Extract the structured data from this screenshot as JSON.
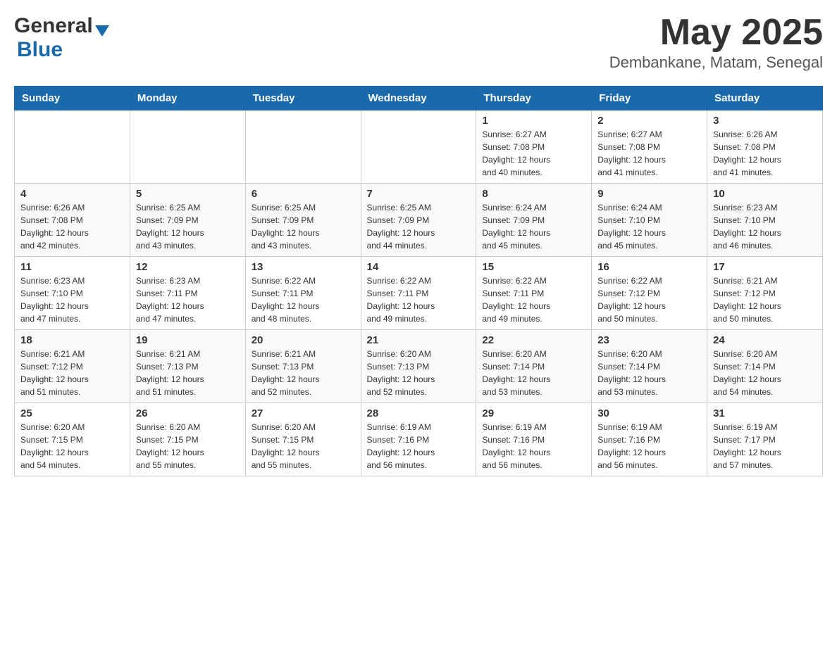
{
  "header": {
    "month_year": "May 2025",
    "location": "Dembankane, Matam, Senegal",
    "logo_general": "General",
    "logo_blue": "Blue"
  },
  "weekdays": [
    "Sunday",
    "Monday",
    "Tuesday",
    "Wednesday",
    "Thursday",
    "Friday",
    "Saturday"
  ],
  "weeks": [
    {
      "days": [
        {
          "date": "",
          "info": ""
        },
        {
          "date": "",
          "info": ""
        },
        {
          "date": "",
          "info": ""
        },
        {
          "date": "",
          "info": ""
        },
        {
          "date": "1",
          "info": "Sunrise: 6:27 AM\nSunset: 7:08 PM\nDaylight: 12 hours\nand 40 minutes."
        },
        {
          "date": "2",
          "info": "Sunrise: 6:27 AM\nSunset: 7:08 PM\nDaylight: 12 hours\nand 41 minutes."
        },
        {
          "date": "3",
          "info": "Sunrise: 6:26 AM\nSunset: 7:08 PM\nDaylight: 12 hours\nand 41 minutes."
        }
      ]
    },
    {
      "days": [
        {
          "date": "4",
          "info": "Sunrise: 6:26 AM\nSunset: 7:08 PM\nDaylight: 12 hours\nand 42 minutes."
        },
        {
          "date": "5",
          "info": "Sunrise: 6:25 AM\nSunset: 7:09 PM\nDaylight: 12 hours\nand 43 minutes."
        },
        {
          "date": "6",
          "info": "Sunrise: 6:25 AM\nSunset: 7:09 PM\nDaylight: 12 hours\nand 43 minutes."
        },
        {
          "date": "7",
          "info": "Sunrise: 6:25 AM\nSunset: 7:09 PM\nDaylight: 12 hours\nand 44 minutes."
        },
        {
          "date": "8",
          "info": "Sunrise: 6:24 AM\nSunset: 7:09 PM\nDaylight: 12 hours\nand 45 minutes."
        },
        {
          "date": "9",
          "info": "Sunrise: 6:24 AM\nSunset: 7:10 PM\nDaylight: 12 hours\nand 45 minutes."
        },
        {
          "date": "10",
          "info": "Sunrise: 6:23 AM\nSunset: 7:10 PM\nDaylight: 12 hours\nand 46 minutes."
        }
      ]
    },
    {
      "days": [
        {
          "date": "11",
          "info": "Sunrise: 6:23 AM\nSunset: 7:10 PM\nDaylight: 12 hours\nand 47 minutes."
        },
        {
          "date": "12",
          "info": "Sunrise: 6:23 AM\nSunset: 7:11 PM\nDaylight: 12 hours\nand 47 minutes."
        },
        {
          "date": "13",
          "info": "Sunrise: 6:22 AM\nSunset: 7:11 PM\nDaylight: 12 hours\nand 48 minutes."
        },
        {
          "date": "14",
          "info": "Sunrise: 6:22 AM\nSunset: 7:11 PM\nDaylight: 12 hours\nand 49 minutes."
        },
        {
          "date": "15",
          "info": "Sunrise: 6:22 AM\nSunset: 7:11 PM\nDaylight: 12 hours\nand 49 minutes."
        },
        {
          "date": "16",
          "info": "Sunrise: 6:22 AM\nSunset: 7:12 PM\nDaylight: 12 hours\nand 50 minutes."
        },
        {
          "date": "17",
          "info": "Sunrise: 6:21 AM\nSunset: 7:12 PM\nDaylight: 12 hours\nand 50 minutes."
        }
      ]
    },
    {
      "days": [
        {
          "date": "18",
          "info": "Sunrise: 6:21 AM\nSunset: 7:12 PM\nDaylight: 12 hours\nand 51 minutes."
        },
        {
          "date": "19",
          "info": "Sunrise: 6:21 AM\nSunset: 7:13 PM\nDaylight: 12 hours\nand 51 minutes."
        },
        {
          "date": "20",
          "info": "Sunrise: 6:21 AM\nSunset: 7:13 PM\nDaylight: 12 hours\nand 52 minutes."
        },
        {
          "date": "21",
          "info": "Sunrise: 6:20 AM\nSunset: 7:13 PM\nDaylight: 12 hours\nand 52 minutes."
        },
        {
          "date": "22",
          "info": "Sunrise: 6:20 AM\nSunset: 7:14 PM\nDaylight: 12 hours\nand 53 minutes."
        },
        {
          "date": "23",
          "info": "Sunrise: 6:20 AM\nSunset: 7:14 PM\nDaylight: 12 hours\nand 53 minutes."
        },
        {
          "date": "24",
          "info": "Sunrise: 6:20 AM\nSunset: 7:14 PM\nDaylight: 12 hours\nand 54 minutes."
        }
      ]
    },
    {
      "days": [
        {
          "date": "25",
          "info": "Sunrise: 6:20 AM\nSunset: 7:15 PM\nDaylight: 12 hours\nand 54 minutes."
        },
        {
          "date": "26",
          "info": "Sunrise: 6:20 AM\nSunset: 7:15 PM\nDaylight: 12 hours\nand 55 minutes."
        },
        {
          "date": "27",
          "info": "Sunrise: 6:20 AM\nSunset: 7:15 PM\nDaylight: 12 hours\nand 55 minutes."
        },
        {
          "date": "28",
          "info": "Sunrise: 6:19 AM\nSunset: 7:16 PM\nDaylight: 12 hours\nand 56 minutes."
        },
        {
          "date": "29",
          "info": "Sunrise: 6:19 AM\nSunset: 7:16 PM\nDaylight: 12 hours\nand 56 minutes."
        },
        {
          "date": "30",
          "info": "Sunrise: 6:19 AM\nSunset: 7:16 PM\nDaylight: 12 hours\nand 56 minutes."
        },
        {
          "date": "31",
          "info": "Sunrise: 6:19 AM\nSunset: 7:17 PM\nDaylight: 12 hours\nand 57 minutes."
        }
      ]
    }
  ]
}
